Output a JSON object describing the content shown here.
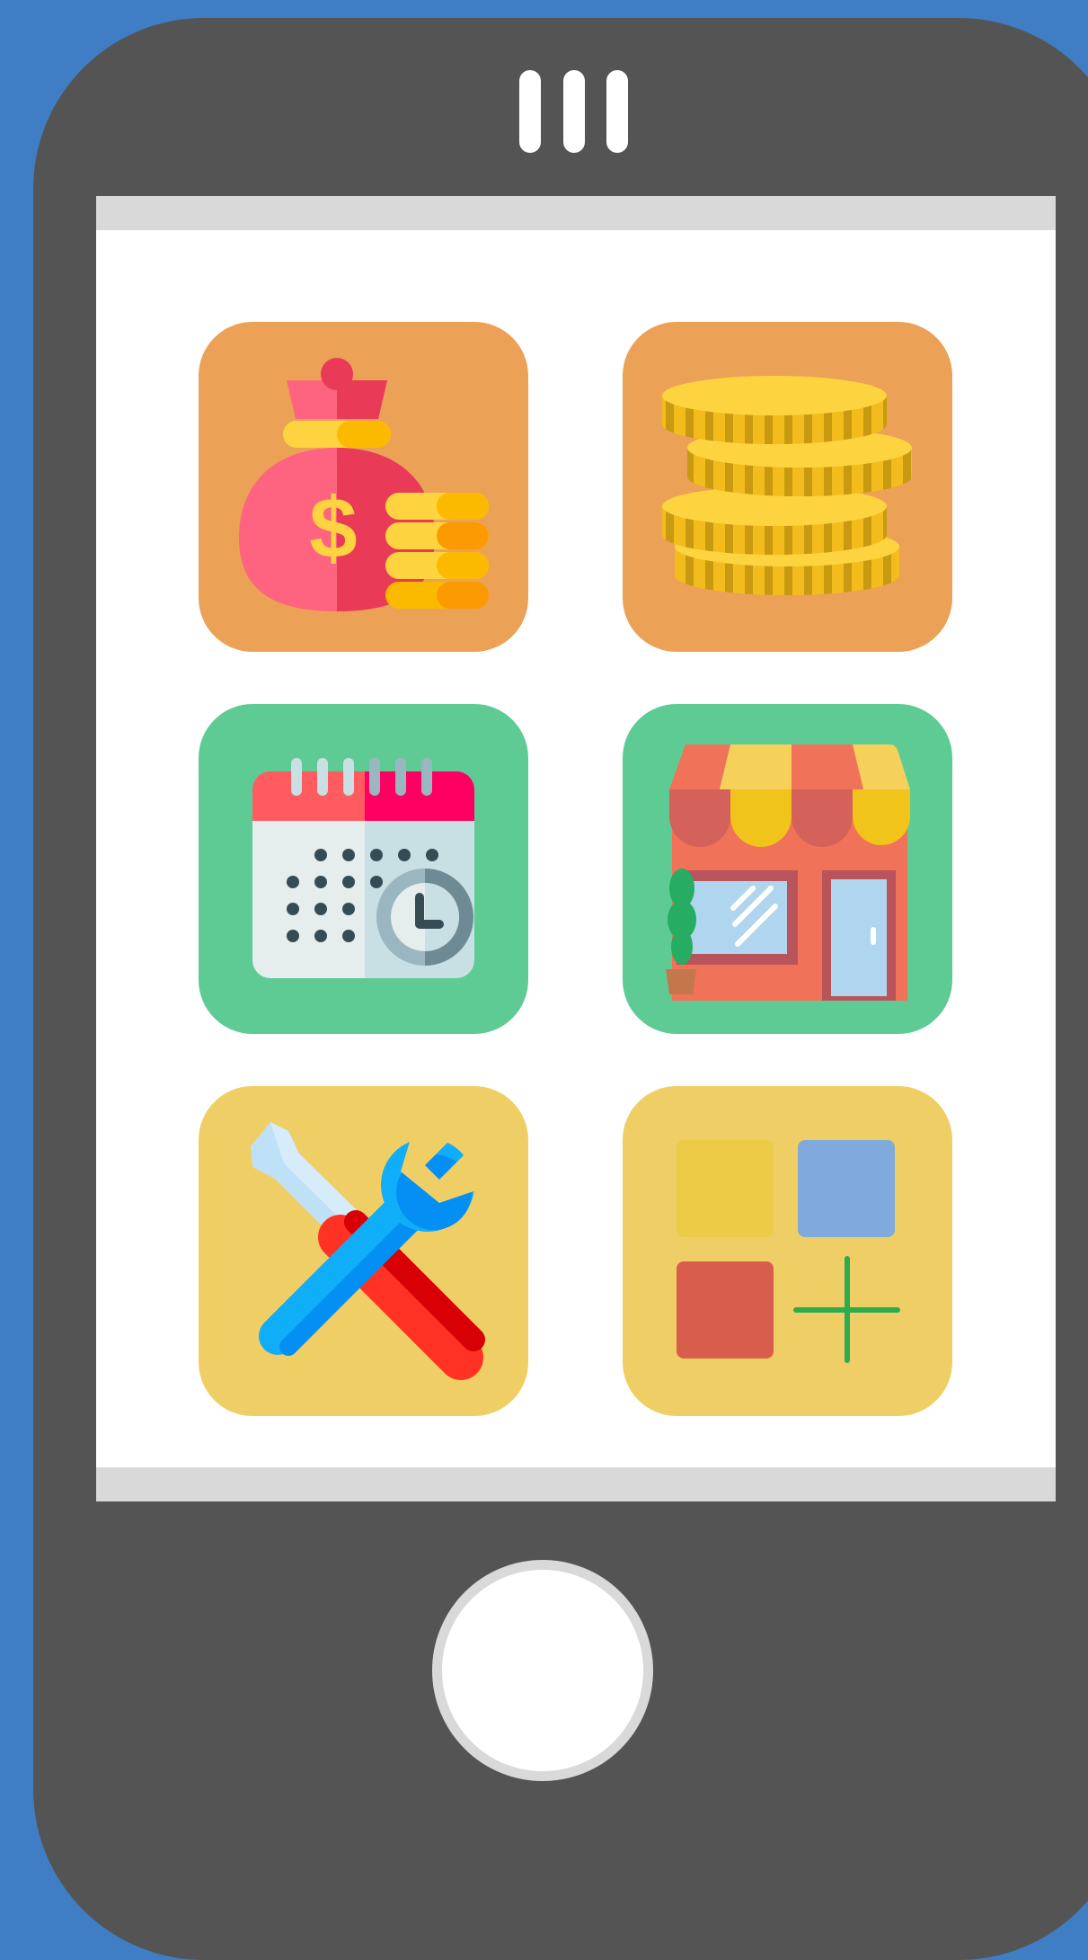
{
  "device": {
    "frame_color": "#545454",
    "background_color": "#3f7ec4",
    "screen_color": "#ffffff",
    "status_bar_color": "#d9d9d9"
  },
  "apps": [
    {
      "icon": "money-bag-icon",
      "tile_color": "#eba156"
    },
    {
      "icon": "coin-stack-icon",
      "tile_color": "#eba156"
    },
    {
      "icon": "calendar-clock-icon",
      "tile_color": "#5fcb94"
    },
    {
      "icon": "storefront-icon",
      "tile_color": "#5fcb94"
    },
    {
      "icon": "tools-icon",
      "tile_color": "#efcf65"
    },
    {
      "icon": "add-app-icon",
      "tile_color": "#efcf65"
    }
  ]
}
